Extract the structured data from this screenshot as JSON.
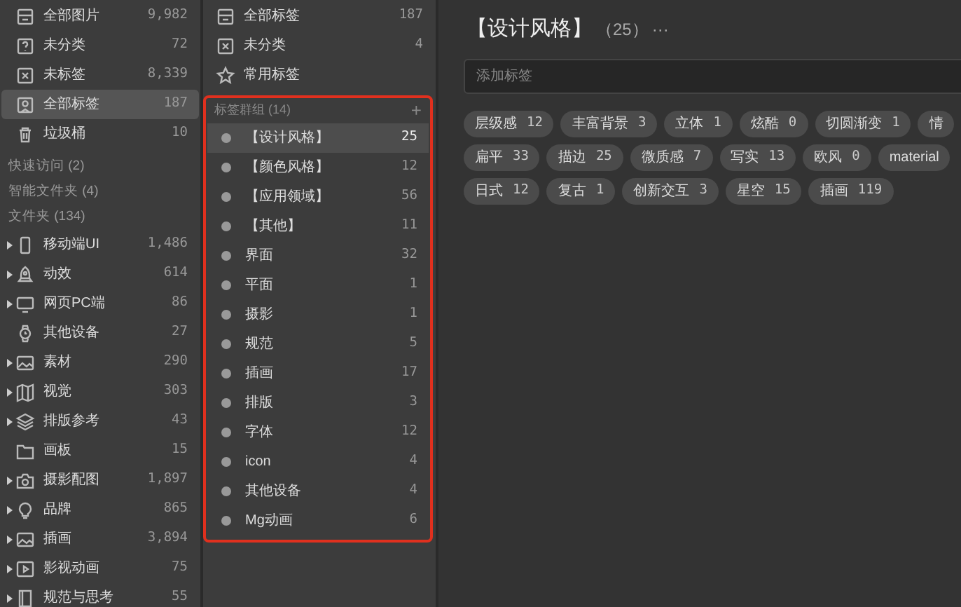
{
  "library": [
    {
      "label": "全部图片",
      "count": "9,982",
      "selected": false
    },
    {
      "label": "未分类",
      "count": "72",
      "selected": false
    },
    {
      "label": "未标签",
      "count": "8,339",
      "selected": false
    },
    {
      "label": "全部标签",
      "count": "187",
      "selected": true
    },
    {
      "label": "垃圾桶",
      "count": "10",
      "selected": false
    }
  ],
  "sections": [
    "快速访问 (2)",
    "智能文件夹 (4)",
    "文件夹 (134)"
  ],
  "folders": [
    {
      "label": "移动端UI",
      "count": "1,486",
      "expandable": true
    },
    {
      "label": "动效",
      "count": "614",
      "expandable": true
    },
    {
      "label": "网页PC端",
      "count": "86",
      "expandable": true
    },
    {
      "label": "其他设备",
      "count": "27",
      "expandable": false
    },
    {
      "label": "素材",
      "count": "290",
      "expandable": true
    },
    {
      "label": "视觉",
      "count": "303",
      "expandable": true
    },
    {
      "label": "排版参考",
      "count": "43",
      "expandable": true
    },
    {
      "label": "画板",
      "count": "15",
      "expandable": false
    },
    {
      "label": "摄影配图",
      "count": "1,897",
      "expandable": true
    },
    {
      "label": "品牌",
      "count": "865",
      "expandable": true
    },
    {
      "label": "插画",
      "count": "3,894",
      "expandable": true
    },
    {
      "label": "影视动画",
      "count": "75",
      "expandable": true
    },
    {
      "label": "规范与思考",
      "count": "55",
      "expandable": true
    }
  ],
  "tag_filters": [
    {
      "label": "全部标签",
      "count": "187"
    },
    {
      "label": "未分类",
      "count": "4"
    },
    {
      "label": "常用标签"
    }
  ],
  "tag_groups": {
    "title": "标签群组 (14)",
    "add": "+",
    "highlighted": true,
    "items": [
      {
        "label": "【设计风格】",
        "count": "25",
        "selected": true
      },
      {
        "label": "【颜色风格】",
        "count": "12",
        "selected": false
      },
      {
        "label": "【应用领域】",
        "count": "56",
        "selected": false
      },
      {
        "label": "【其他】",
        "count": "11",
        "selected": false
      },
      {
        "label": "界面",
        "count": "32",
        "selected": false
      },
      {
        "label": "平面",
        "count": "1",
        "selected": false
      },
      {
        "label": "摄影",
        "count": "1",
        "selected": false
      },
      {
        "label": "规范",
        "count": "5",
        "selected": false
      },
      {
        "label": "插画",
        "count": "17",
        "selected": false
      },
      {
        "label": "排版",
        "count": "3",
        "selected": false
      },
      {
        "label": "字体",
        "count": "12",
        "selected": false
      },
      {
        "label": "icon",
        "count": "4",
        "selected": false
      },
      {
        "label": "其他设备",
        "count": "4",
        "selected": false
      },
      {
        "label": "Mg动画",
        "count": "6",
        "selected": false
      }
    ]
  },
  "detail": {
    "title": "【设计风格】",
    "count": "（25）",
    "more": "···",
    "search": {
      "placeholder": "添加标签"
    },
    "tag_rows": [
      [
        {
          "label": "层级感",
          "count": "12"
        },
        {
          "label": "丰富背景",
          "count": "3"
        },
        {
          "label": "立体",
          "count": "1"
        },
        {
          "label": "炫酷",
          "count": "0"
        },
        {
          "label": "切圆渐变",
          "count": "1"
        },
        {
          "label": "情"
        }
      ],
      [
        {
          "label": "扁平",
          "count": "33"
        },
        {
          "label": "描边",
          "count": "25"
        },
        {
          "label": "微质感",
          "count": "7"
        },
        {
          "label": "写实",
          "count": "13"
        },
        {
          "label": "欧风",
          "count": "0"
        },
        {
          "label": "material"
        }
      ],
      [
        {
          "label": "日式",
          "count": "12"
        },
        {
          "label": "复古",
          "count": "1"
        },
        {
          "label": "创新交互",
          "count": "3"
        },
        {
          "label": "星空",
          "count": "15"
        },
        {
          "label": "插画",
          "count": "119"
        }
      ]
    ]
  }
}
